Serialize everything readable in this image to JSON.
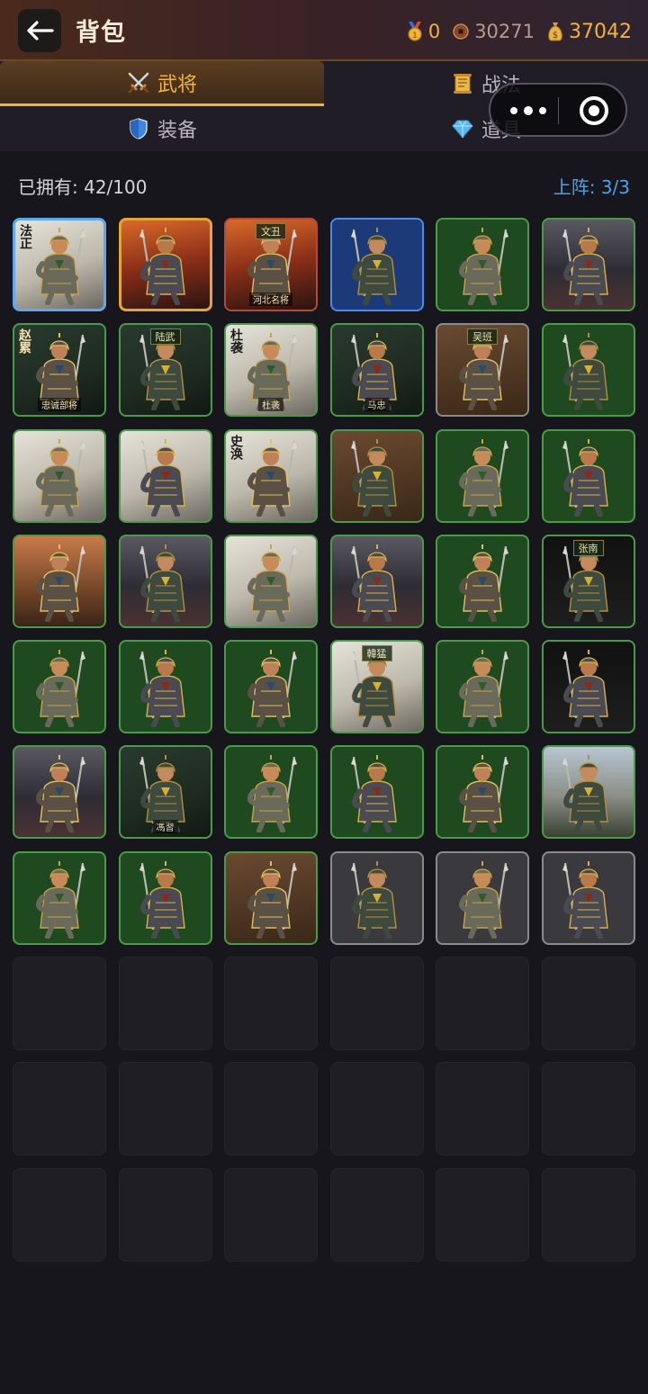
{
  "header": {
    "title": "背包",
    "currencies": [
      {
        "icon": "medal-icon",
        "value": "0"
      },
      {
        "icon": "copper-coin-icon",
        "value": "30271"
      },
      {
        "icon": "money-bag-icon",
        "value": "37042"
      }
    ]
  },
  "tabs": [
    {
      "label": "武将",
      "icon": "crossed-swords-icon",
      "active": true
    },
    {
      "label": "战法",
      "icon": "scroll-icon",
      "active": false
    },
    {
      "label": "装备",
      "icon": "shield-icon",
      "active": false
    },
    {
      "label": "道具",
      "icon": "gem-icon",
      "active": false
    }
  ],
  "inventory": {
    "owned_label": "已拥有: 42/100",
    "deployed_label": "上阵: 3/3"
  },
  "cards": [
    {
      "rarity": "blue",
      "bg": "ink",
      "banner": "法正",
      "plate": ""
    },
    {
      "rarity": "gold",
      "bg": "fire",
      "banner": "",
      "plate": ""
    },
    {
      "rarity": "red",
      "bg": "fire",
      "banner": "",
      "top": "文丑",
      "plate": "河北名将"
    },
    {
      "rarity": "blue2",
      "bg": "",
      "banner": "",
      "plate": ""
    },
    {
      "rarity": "green",
      "bg": "",
      "banner": "",
      "plate": ""
    },
    {
      "rarity": "green",
      "bg": "storm",
      "banner": "",
      "plate": ""
    },
    {
      "rarity": "green",
      "bg": "dark",
      "banner": "赵累",
      "plate": "忠诚部将"
    },
    {
      "rarity": "green",
      "bg": "dark",
      "banner": "",
      "top": "陆武",
      "plate": ""
    },
    {
      "rarity": "green",
      "bg": "ink",
      "banner": "杜袭",
      "plate": "杜袭"
    },
    {
      "rarity": "green",
      "bg": "dark",
      "banner": "",
      "top": "",
      "plate": "马忠"
    },
    {
      "rarity": "grey",
      "bg": "brown",
      "banner": "",
      "top": "吴班",
      "plate": ""
    },
    {
      "rarity": "green",
      "bg": "",
      "banner": "",
      "plate": ""
    },
    {
      "rarity": "green",
      "bg": "ink",
      "banner": "",
      "plate": ""
    },
    {
      "rarity": "green",
      "bg": "ink",
      "banner": "",
      "plate": ""
    },
    {
      "rarity": "green",
      "bg": "ink",
      "banner": "史涣",
      "plate": ""
    },
    {
      "rarity": "green",
      "bg": "brown",
      "banner": "",
      "plate": ""
    },
    {
      "rarity": "green",
      "bg": "",
      "banner": "",
      "plate": ""
    },
    {
      "rarity": "green",
      "bg": "",
      "banner": "",
      "plate": ""
    },
    {
      "rarity": "green",
      "bg": "sunset",
      "banner": "",
      "plate": ""
    },
    {
      "rarity": "green",
      "bg": "storm",
      "banner": "",
      "plate": ""
    },
    {
      "rarity": "green",
      "bg": "ink",
      "banner": "",
      "plate": ""
    },
    {
      "rarity": "green",
      "bg": "storm",
      "banner": "",
      "plate": ""
    },
    {
      "rarity": "green",
      "bg": "",
      "banner": "",
      "plate": ""
    },
    {
      "rarity": "green",
      "bg": "black",
      "banner": "",
      "top": "张南",
      "plate": ""
    },
    {
      "rarity": "green",
      "bg": "",
      "banner": "",
      "plate": ""
    },
    {
      "rarity": "green",
      "bg": "",
      "banner": "",
      "plate": ""
    },
    {
      "rarity": "green",
      "bg": "",
      "banner": "",
      "plate": ""
    },
    {
      "rarity": "green",
      "bg": "ink",
      "banner": "",
      "top": "韓猛",
      "plate": ""
    },
    {
      "rarity": "green",
      "bg": "",
      "banner": "",
      "plate": ""
    },
    {
      "rarity": "green",
      "bg": "black",
      "banner": "",
      "plate": ""
    },
    {
      "rarity": "green",
      "bg": "storm",
      "banner": "",
      "plate": ""
    },
    {
      "rarity": "green",
      "bg": "dark",
      "banner": "",
      "plate": "馮習"
    },
    {
      "rarity": "green",
      "bg": "",
      "banner": "",
      "plate": ""
    },
    {
      "rarity": "green",
      "bg": "",
      "banner": "",
      "plate": ""
    },
    {
      "rarity": "green",
      "bg": "",
      "banner": "",
      "plate": ""
    },
    {
      "rarity": "green",
      "bg": "sky",
      "banner": "",
      "plate": ""
    },
    {
      "rarity": "green",
      "bg": "",
      "banner": "",
      "plate": ""
    },
    {
      "rarity": "green",
      "bg": "",
      "banner": "",
      "plate": ""
    },
    {
      "rarity": "green",
      "bg": "brown",
      "banner": "",
      "top": "",
      "plate": ""
    },
    {
      "rarity": "grey",
      "bg": "",
      "banner": "",
      "plate": ""
    },
    {
      "rarity": "grey",
      "bg": "",
      "banner": "",
      "plate": ""
    },
    {
      "rarity": "grey",
      "bg": "",
      "banner": "",
      "plate": ""
    }
  ],
  "capacity_slots": 60,
  "colors": {
    "accent_gold": "#f2b33b",
    "deployed_blue": "#4aa3ee",
    "card_green": "#1f4a1f"
  }
}
